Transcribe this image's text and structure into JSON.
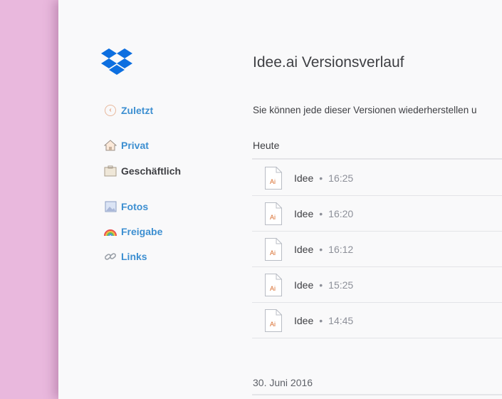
{
  "sidebar": {
    "back_label": "Zuletzt",
    "private_label": "Privat",
    "business_label": "Geschäftlich",
    "photos_label": "Fotos",
    "sharing_label": "Freigabe",
    "links_label": "Links"
  },
  "main": {
    "title": "Idee.ai Versionsverlauf",
    "subtitle": "Sie können jede dieser Versionen wiederherstellen u",
    "groups": [
      {
        "label": "Heute",
        "versions": [
          {
            "name": "Idee",
            "separator": "•",
            "time": "16:25",
            "icon_text": "Ai"
          },
          {
            "name": "Idee",
            "separator": "•",
            "time": "16:20",
            "icon_text": "Ai"
          },
          {
            "name": "Idee",
            "separator": "•",
            "time": "16:12",
            "icon_text": "Ai"
          },
          {
            "name": "Idee",
            "separator": "•",
            "time": "15:25",
            "icon_text": "Ai"
          },
          {
            "name": "Idee",
            "separator": "•",
            "time": "14:45",
            "icon_text": "Ai"
          }
        ]
      },
      {
        "label": "30. Juni 2016",
        "versions": []
      }
    ]
  },
  "colors": {
    "background": "#e9b8dd",
    "panel": "#f9f9fa",
    "link": "#3d8fd1",
    "brand": "#0061fe",
    "ai_file": "#d86c2c"
  }
}
